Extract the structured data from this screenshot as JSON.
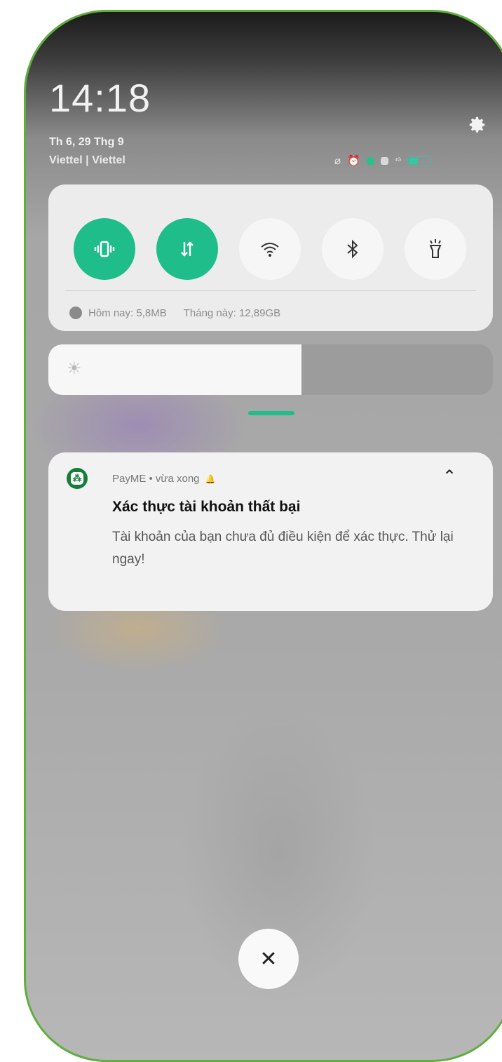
{
  "status": {
    "time": "14:18",
    "date": "Th 6, 29 Thg 9",
    "carrier": "Viettel | Viettel",
    "icons": [
      "vibrate-off-icon",
      "alarm-icon",
      "signal-icon",
      "hd-icon",
      "4g-icon",
      "battery-icon"
    ],
    "accent_color": "#1fbd89"
  },
  "quick_settings": {
    "toggles": [
      {
        "name": "vibrate",
        "icon": "vibrate-icon",
        "active": true
      },
      {
        "name": "mobile-data",
        "icon": "data-arrows-icon",
        "active": true
      },
      {
        "name": "wifi",
        "icon": "wifi-icon",
        "active": false
      },
      {
        "name": "bluetooth",
        "icon": "bluetooth-icon",
        "active": false
      },
      {
        "name": "flashlight",
        "icon": "flashlight-icon",
        "active": false
      }
    ],
    "data_today": "Hôm nay: 5,8MB",
    "data_month": "Tháng này: 12,89GB"
  },
  "brightness": {
    "level": 0.57,
    "icon": "sun-icon"
  },
  "notification": {
    "app": "PayME",
    "time": "vừa xong",
    "header": "PayME • vừa xong",
    "title": "Xác thực tài khoản thất bại",
    "body": "Tài khoản của bạn chưa đủ điều kiện để xác thực. Thử lại ngay!"
  },
  "clear_button": {
    "symbol": "✕"
  }
}
